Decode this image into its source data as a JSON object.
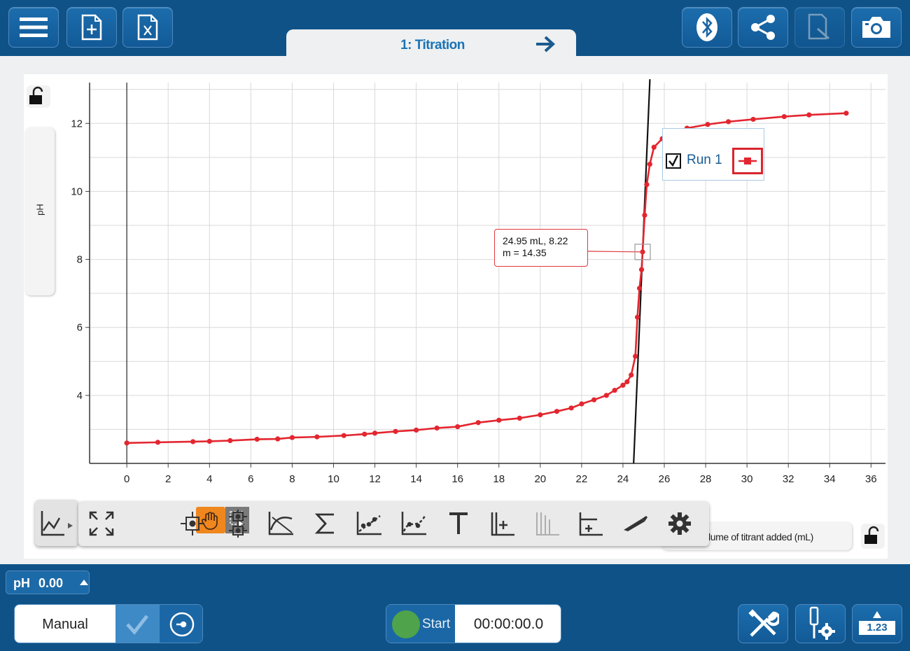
{
  "toolbar_top": {
    "menu_icon": "hamburger-menu-icon",
    "new_file_icon": "new-file-icon",
    "open_file_icon": "file-x-icon",
    "bluetooth_icon": "bluetooth-icon",
    "share_icon": "share-icon",
    "notes_icon": "journal-icon",
    "snapshot_icon": "camera-icon"
  },
  "tab": {
    "title": "1: Titration",
    "next_icon": "arrow-right-icon"
  },
  "graph": {
    "y_axis_label": "pH",
    "x_axis_label_visible": "lume of titrant added (mL)",
    "legend": {
      "run_label": "Run 1",
      "checked": true,
      "series_color": "#e3262f"
    },
    "tooltip": {
      "line1": "24.95 mL, 8.22",
      "line2": "m = 14.35"
    }
  },
  "chart_data": {
    "type": "line",
    "title": "",
    "xlabel": "Volume of titrant added (mL)",
    "ylabel": "pH",
    "xlim": [
      -1.8,
      36.7
    ],
    "ylim": [
      2.0,
      13.2
    ],
    "x_ticks": [
      "0",
      "2",
      "4",
      "6",
      "8",
      "10",
      "12",
      "14",
      "16",
      "18",
      "20",
      "22",
      "24",
      "26",
      "28",
      "30",
      "32",
      "34",
      "36"
    ],
    "y_ticks": [
      "4",
      "6",
      "8",
      "10",
      "12"
    ],
    "grid": true,
    "legend_position": "top-right",
    "series": [
      {
        "name": "Run 1",
        "color": "#e3262f",
        "x": [
          0,
          1.5,
          3.2,
          4.0,
          5.0,
          6.3,
          7.3,
          8.0,
          9.2,
          10.5,
          11.5,
          12.0,
          13.0,
          14.0,
          15.0,
          16.0,
          17.0,
          18.0,
          19.0,
          20.0,
          20.8,
          21.5,
          22.0,
          22.6,
          23.2,
          23.6,
          24.0,
          24.2,
          24.4,
          24.6,
          24.7,
          24.8,
          24.9,
          24.95,
          25.05,
          25.15,
          25.3,
          25.5,
          25.9,
          26.4,
          27.1,
          28.1,
          29.1,
          30.3,
          31.8,
          33.0,
          34.8
        ],
        "y": [
          2.6,
          2.62,
          2.64,
          2.65,
          2.67,
          2.71,
          2.72,
          2.76,
          2.78,
          2.82,
          2.86,
          2.89,
          2.94,
          2.98,
          3.04,
          3.08,
          3.2,
          3.27,
          3.33,
          3.43,
          3.53,
          3.63,
          3.75,
          3.87,
          4.0,
          4.15,
          4.3,
          4.4,
          4.6,
          5.15,
          6.3,
          7.15,
          7.7,
          8.22,
          9.3,
          10.2,
          10.8,
          11.3,
          11.55,
          11.75,
          11.86,
          11.97,
          12.05,
          12.12,
          12.2,
          12.25,
          12.3
        ]
      }
    ],
    "tangent": {
      "slope": 14.35,
      "x0": 24.95,
      "y0": 8.22
    }
  },
  "graph_tools": [
    {
      "name": "graph-type-icon"
    },
    {
      "name": "autoscale-icon"
    },
    {
      "name": "pan-icon"
    },
    {
      "name": "select-area-icon"
    },
    {
      "name": "coordinates-icon"
    },
    {
      "name": "delta-icon"
    },
    {
      "name": "slope-tangent-icon"
    },
    {
      "name": "sigma-statistics-icon"
    },
    {
      "name": "linear-fit-icon"
    },
    {
      "name": "curve-fit-icon"
    },
    {
      "name": "text-annotation-icon"
    },
    {
      "name": "add-y-axis-icon"
    },
    {
      "name": "remove-y-axis-icon"
    },
    {
      "name": "add-x-axis-icon"
    },
    {
      "name": "sketch-pen-icon"
    },
    {
      "name": "settings-gear-icon"
    }
  ],
  "meter": {
    "name": "pH",
    "value": "0.00"
  },
  "controls": {
    "mode_label": "Manual",
    "start_label": "Start",
    "timer": "00:00:00.0",
    "start_color": "#4fa34a",
    "tools_icon": "wrench-screwdriver-icon",
    "sensor_settings_icon": "sensor-gear-icon",
    "digits_icon_text": "1.23"
  }
}
